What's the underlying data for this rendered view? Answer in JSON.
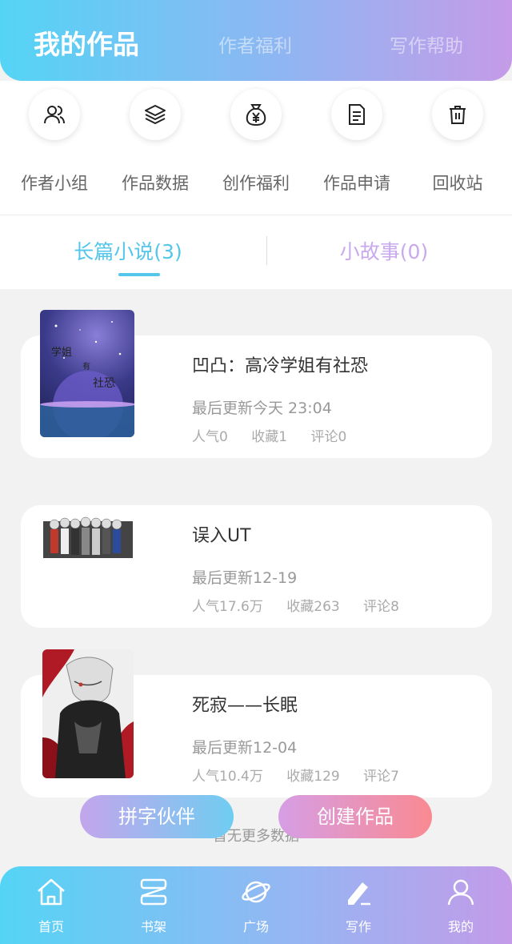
{
  "header": {
    "tabs": [
      {
        "label": "我的作品"
      },
      {
        "label": "作者福利"
      },
      {
        "label": "写作帮助"
      }
    ]
  },
  "quick_actions": [
    {
      "label": "作者小组",
      "icon": "author-group-icon"
    },
    {
      "label": "作品数据",
      "icon": "layers-icon"
    },
    {
      "label": "创作福利",
      "icon": "money-bag-icon"
    },
    {
      "label": "作品申请",
      "icon": "document-icon"
    },
    {
      "label": "回收站",
      "icon": "trash-icon"
    }
  ],
  "subtabs": [
    {
      "label": "长篇小说(3)"
    },
    {
      "label": "小故事(0)"
    }
  ],
  "works": [
    {
      "title": "凹凸：高冷学姐有社恐",
      "updated": "最后更新今天 23:04",
      "popularity": "人气0",
      "favorites": "收藏1",
      "comments": "评论0",
      "cover_text": [
        "学姐",
        "有",
        "社恐"
      ]
    },
    {
      "title": "误入UT",
      "updated": "最后更新12-19",
      "popularity": "人气17.6万",
      "favorites": "收藏263",
      "comments": "评论8"
    },
    {
      "title": "死寂——长眠",
      "updated": "最后更新12-04",
      "popularity": "人气10.4万",
      "favorites": "收藏129",
      "comments": "评论7"
    }
  ],
  "list_footer": "暂无更多数据",
  "buttons": {
    "partner": "拼字伙伴",
    "create": "创建作品"
  },
  "tabbar": [
    {
      "label": "首页",
      "icon": "home-icon"
    },
    {
      "label": "书架",
      "icon": "bookshelf-icon"
    },
    {
      "label": "广场",
      "icon": "planet-icon"
    },
    {
      "label": "写作",
      "icon": "pen-icon"
    },
    {
      "label": "我的",
      "icon": "user-icon"
    }
  ],
  "colors": {
    "accent": "#54c6eb",
    "secondary_tab": "#c9a9ee",
    "create_button": "#f98a92"
  }
}
